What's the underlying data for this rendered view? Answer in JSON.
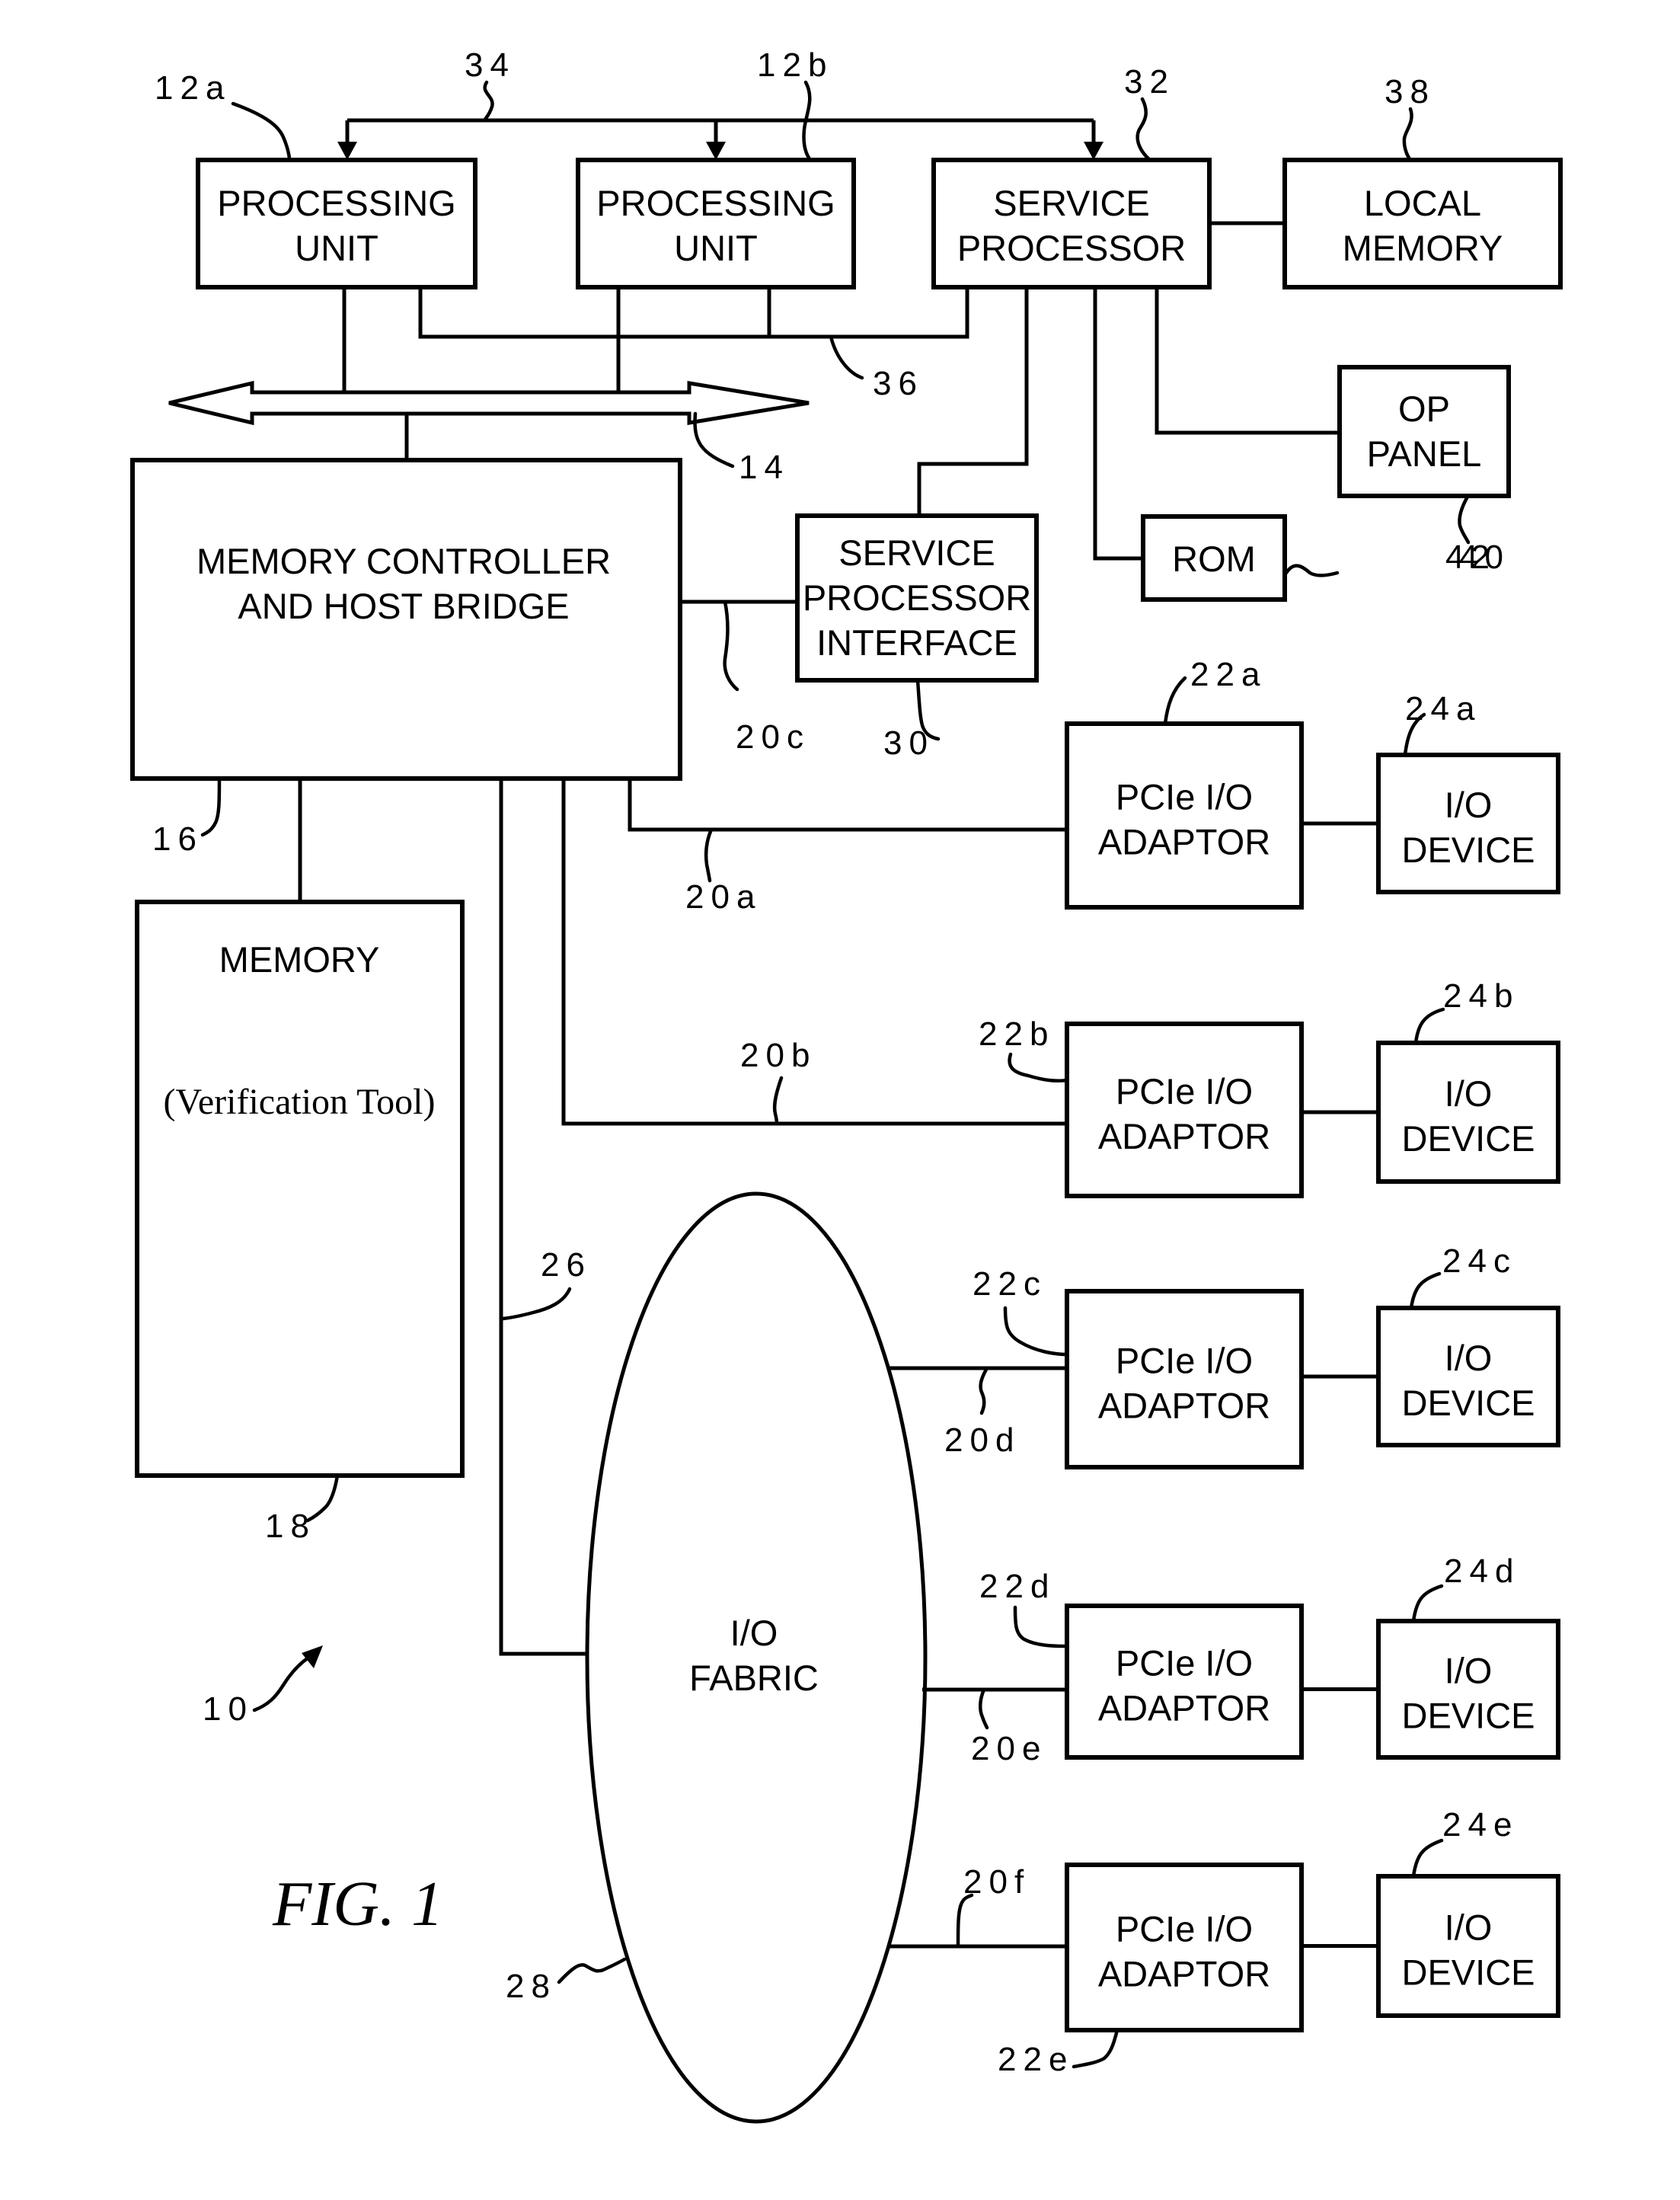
{
  "figure": {
    "caption": "FIG. 1",
    "system_ref": "10"
  },
  "colors": {
    "ink": "#000000",
    "paper": "#ffffff"
  },
  "blocks": {
    "processing_unit_a": {
      "line1": "PROCESSING",
      "line2": "UNIT",
      "ref": "12a"
    },
    "processing_unit_b": {
      "line1": "PROCESSING",
      "line2": "UNIT",
      "ref": "12b"
    },
    "service_processor": {
      "line1": "SERVICE",
      "line2": "PROCESSOR",
      "ref": "32"
    },
    "local_memory": {
      "line1": "LOCAL",
      "line2": "MEMORY",
      "ref": "38"
    },
    "op_panel": {
      "line1": "OP",
      "line2": "PANEL",
      "ref": "42"
    },
    "rom": {
      "line1": "ROM",
      "ref": "40"
    },
    "service_processor_interface": {
      "line1": "SERVICE",
      "line2": "PROCESSOR",
      "line3": "INTERFACE",
      "ref": "30"
    },
    "memory_controller": {
      "line1": "MEMORY CONTROLLER",
      "line2": "AND HOST BRIDGE",
      "ref": "16"
    },
    "memory": {
      "line1": "MEMORY",
      "line2": "(Verification Tool)",
      "ref": "18"
    },
    "io_fabric": {
      "line1": "I/O",
      "line2": "FABRIC",
      "ref": "28"
    },
    "adaptors": [
      {
        "line1": "PCIe I/O",
        "line2": "ADAPTOR",
        "ref": "22a"
      },
      {
        "line1": "PCIe I/O",
        "line2": "ADAPTOR",
        "ref": "22b"
      },
      {
        "line1": "PCIe I/O",
        "line2": "ADAPTOR",
        "ref": "22c"
      },
      {
        "line1": "PCIe I/O",
        "line2": "ADAPTOR",
        "ref": "22d"
      },
      {
        "line1": "PCIe I/O",
        "line2": "ADAPTOR",
        "ref": "22e"
      }
    ],
    "devices": [
      {
        "line1": "I/O",
        "line2": "DEVICE",
        "ref": "24a"
      },
      {
        "line1": "I/O",
        "line2": "DEVICE",
        "ref": "24b"
      },
      {
        "line1": "I/O",
        "line2": "DEVICE",
        "ref": "24c"
      },
      {
        "line1": "I/O",
        "line2": "DEVICE",
        "ref": "24d"
      },
      {
        "line1": "I/O",
        "line2": "DEVICE",
        "ref": "24e"
      }
    ]
  },
  "connections": {
    "service_bus": "34",
    "system_bus": "14",
    "jtag_bus": "36",
    "fabric_link": "26",
    "links": [
      "20a",
      "20b",
      "20c",
      "20d",
      "20e",
      "20f"
    ]
  }
}
